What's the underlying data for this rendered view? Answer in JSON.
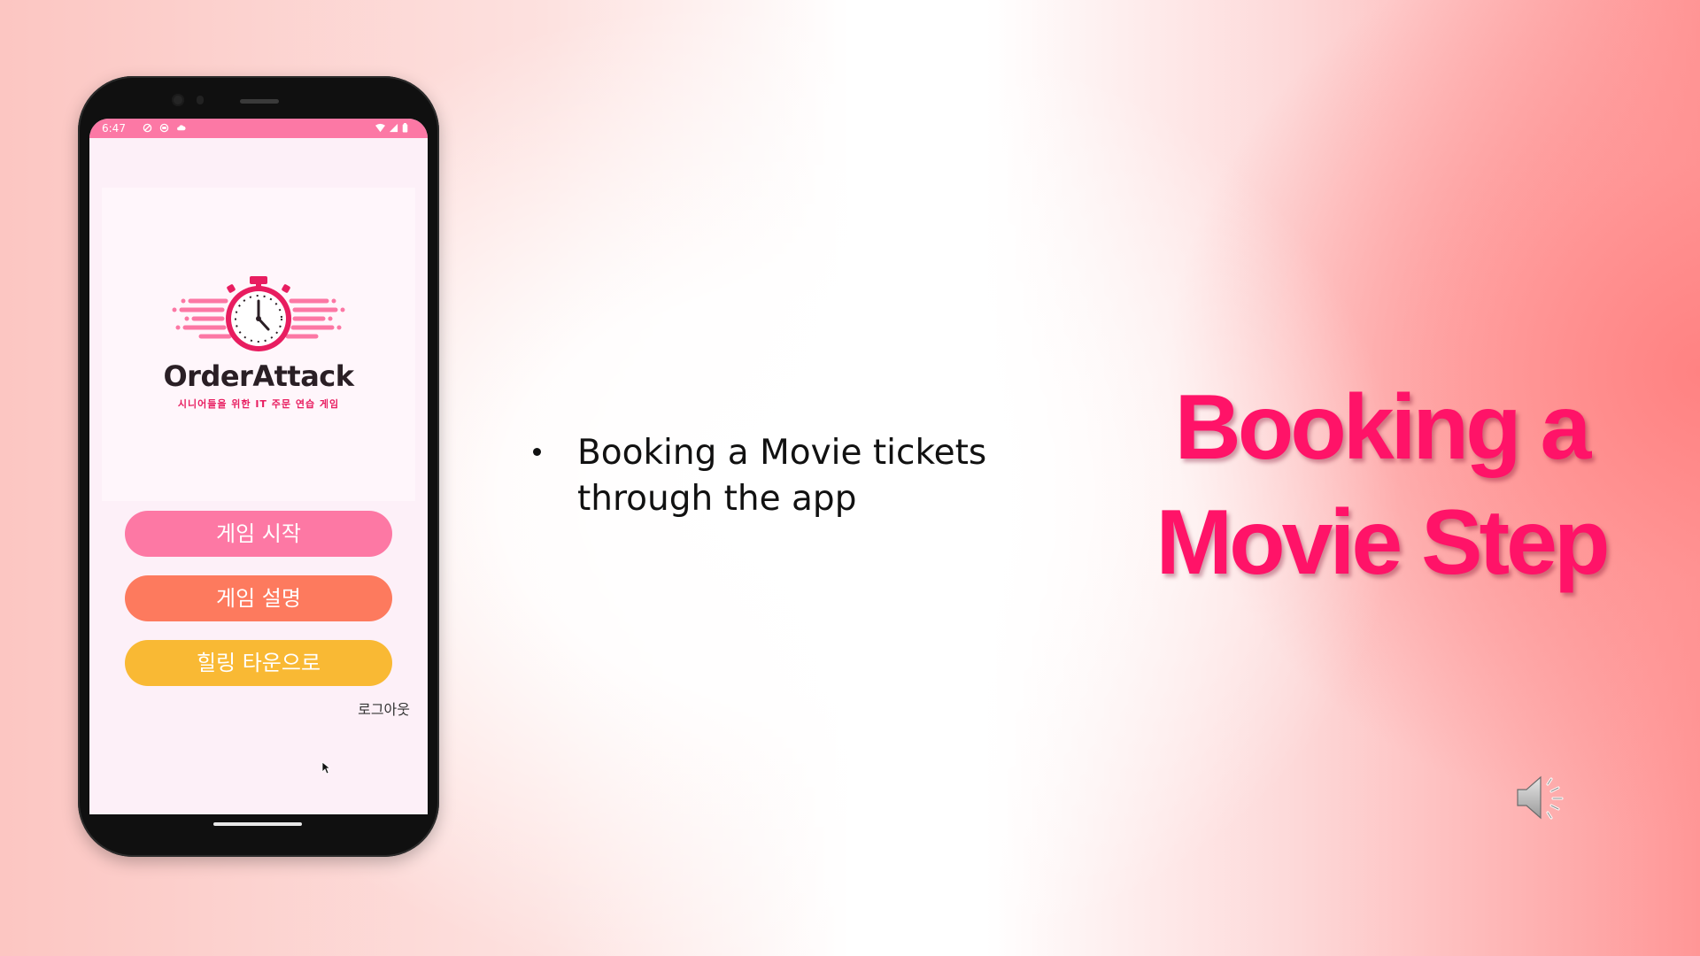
{
  "phone": {
    "status_time": "6:47",
    "app": {
      "logo_title": "OrderAttack",
      "logo_subtitle": "시니어들을 위한 IT 주문 연습 게임",
      "buttons": {
        "start": "게임 시작",
        "guide": "게임 설명",
        "town": "힐링 타운으로"
      },
      "logout": "로그아웃"
    }
  },
  "slide": {
    "bullet": "Booking a Movie tickets through the app",
    "title_line1": "Booking a",
    "title_line2": "Movie Step"
  },
  "colors": {
    "status_bar": "#fc78a5",
    "btn_start": "#fd78a4",
    "btn_guide": "#fd7a5e",
    "btn_town": "#f9b934",
    "title": "#ff1368",
    "logo_accent": "#e81d60"
  },
  "icons": {
    "speaker": "speaker-volume-icon",
    "cursor": "mouse-cursor-icon"
  }
}
